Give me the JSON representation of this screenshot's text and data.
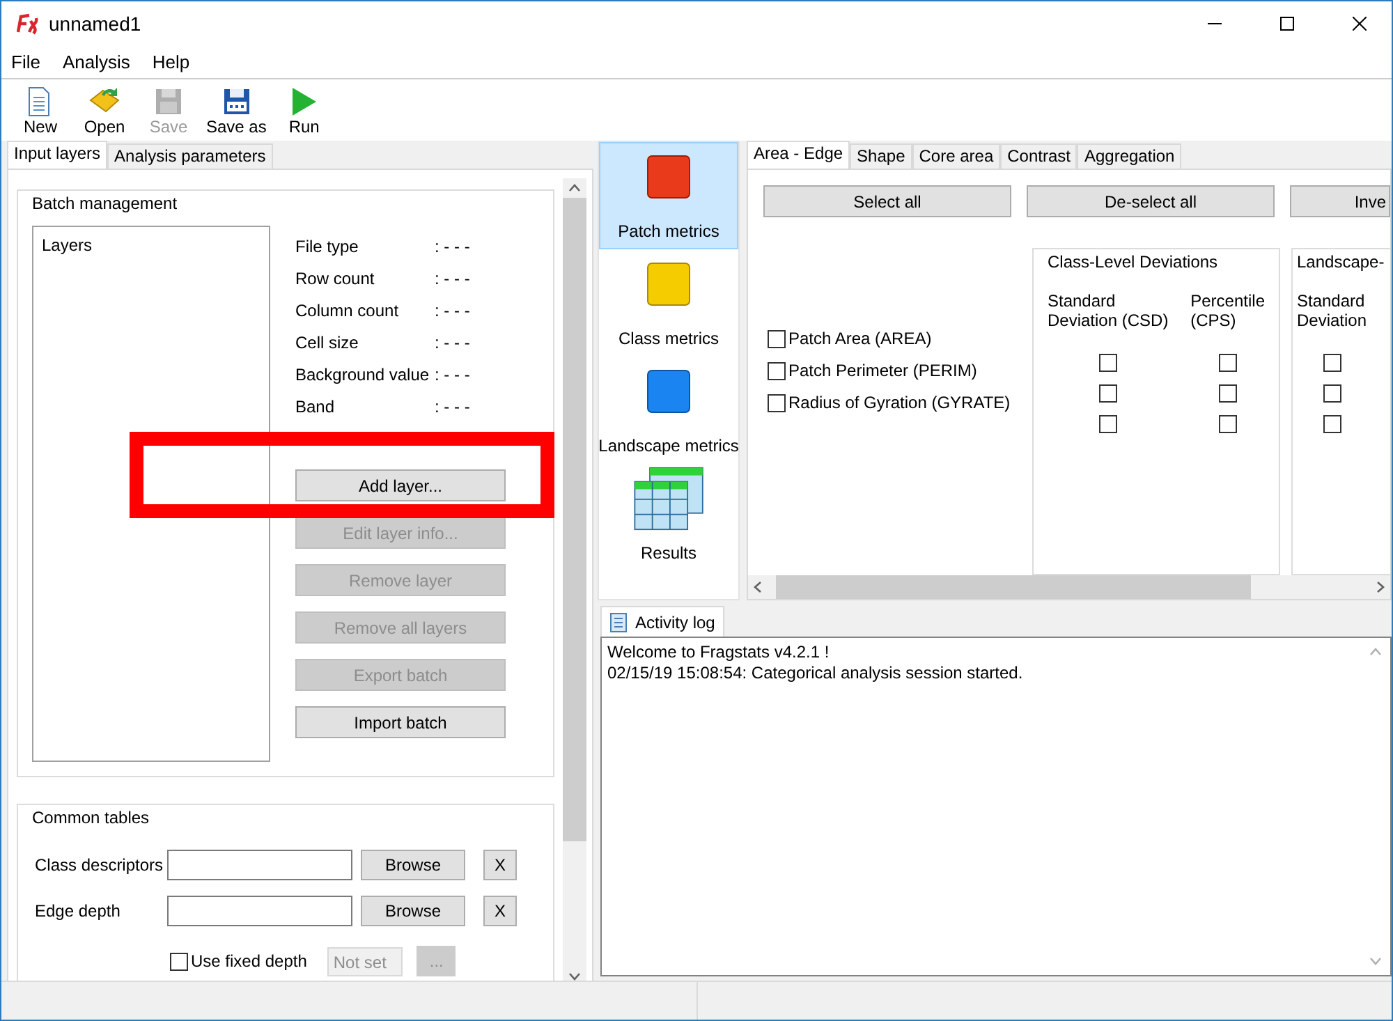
{
  "window": {
    "title": "unnamed1"
  },
  "menu": [
    "File",
    "Analysis",
    "Help"
  ],
  "toolbar": [
    {
      "label": "New",
      "kind": "new",
      "disabled": false
    },
    {
      "label": "Open",
      "kind": "open",
      "disabled": false
    },
    {
      "label": "Save",
      "kind": "save",
      "disabled": true
    },
    {
      "label": "Save as",
      "kind": "saveas",
      "disabled": false
    },
    {
      "label": "Run",
      "kind": "run",
      "disabled": false
    }
  ],
  "left_tabs": [
    {
      "label": "Input layers",
      "selected": true
    },
    {
      "label": "Analysis parameters",
      "selected": false
    }
  ],
  "batch": {
    "title": "Batch management",
    "layers_label": "Layers",
    "info": [
      {
        "label": "File type",
        "value": ": - - -"
      },
      {
        "label": "Row count",
        "value": ": - - -"
      },
      {
        "label": "Column count",
        "value": ": - - -"
      },
      {
        "label": "Cell size",
        "value": ": - - -"
      },
      {
        "label": "Background value",
        "value": ": - - -"
      },
      {
        "label": "Band",
        "value": ": - - -"
      }
    ],
    "buttons": [
      {
        "label": "Add layer...",
        "disabled": false
      },
      {
        "label": "Edit layer info...",
        "disabled": true
      },
      {
        "label": "Remove layer",
        "disabled": true
      },
      {
        "label": "Remove all layers",
        "disabled": true
      },
      {
        "label": "Export batch",
        "disabled": true
      },
      {
        "label": "Import batch",
        "disabled": false
      }
    ]
  },
  "common_tables": {
    "title": "Common tables",
    "rows": [
      {
        "label": "Class descriptors",
        "button": "Browse",
        "clear": "X"
      },
      {
        "label": "Edge depth",
        "button": "Browse",
        "clear": "X"
      }
    ],
    "fixed_depth": {
      "label": "Use fixed depth",
      "checked": false,
      "value": "Not set",
      "more": "..."
    }
  },
  "metric_levels": [
    {
      "label": "Patch metrics",
      "kind": "patch",
      "selected": true
    },
    {
      "label": "Class metrics",
      "kind": "class",
      "selected": false
    },
    {
      "label": "Landscape metrics",
      "kind": "landscape",
      "selected": false
    },
    {
      "label": "Results",
      "kind": "results",
      "selected": false
    }
  ],
  "metric_tabs": [
    {
      "label": "Area - Edge",
      "selected": true
    },
    {
      "label": "Shape",
      "selected": false
    },
    {
      "label": "Core area",
      "selected": false
    },
    {
      "label": "Contrast",
      "selected": false
    },
    {
      "label": "Aggregation",
      "selected": false
    }
  ],
  "actions": [
    "Select all",
    "De-select all",
    "Inve"
  ],
  "deviation_groups": [
    {
      "title": "Class-Level Deviations",
      "columns": [
        [
          "Standard",
          "Deviation  (CSD)"
        ],
        [
          "Percentile",
          "(CPS)"
        ]
      ]
    },
    {
      "title": "Landscape-",
      "columns": [
        [
          "Standard",
          "Deviation"
        ]
      ]
    }
  ],
  "metrics": [
    {
      "label": "Patch Area  (AREA)",
      "checked": false,
      "deviations": [
        false,
        false,
        false
      ]
    },
    {
      "label": "Patch Perimeter  (PERIM)",
      "checked": false,
      "deviations": [
        false,
        false,
        false
      ]
    },
    {
      "label": "Radius of Gyration  (GYRATE)",
      "checked": false,
      "deviations": [
        false,
        false,
        false
      ]
    }
  ],
  "activity_log": {
    "tab": "Activity log",
    "lines": [
      "Welcome to Fragstats v4.2.1 !",
      "02/15/19 15:08:54: Categorical analysis session started."
    ]
  }
}
